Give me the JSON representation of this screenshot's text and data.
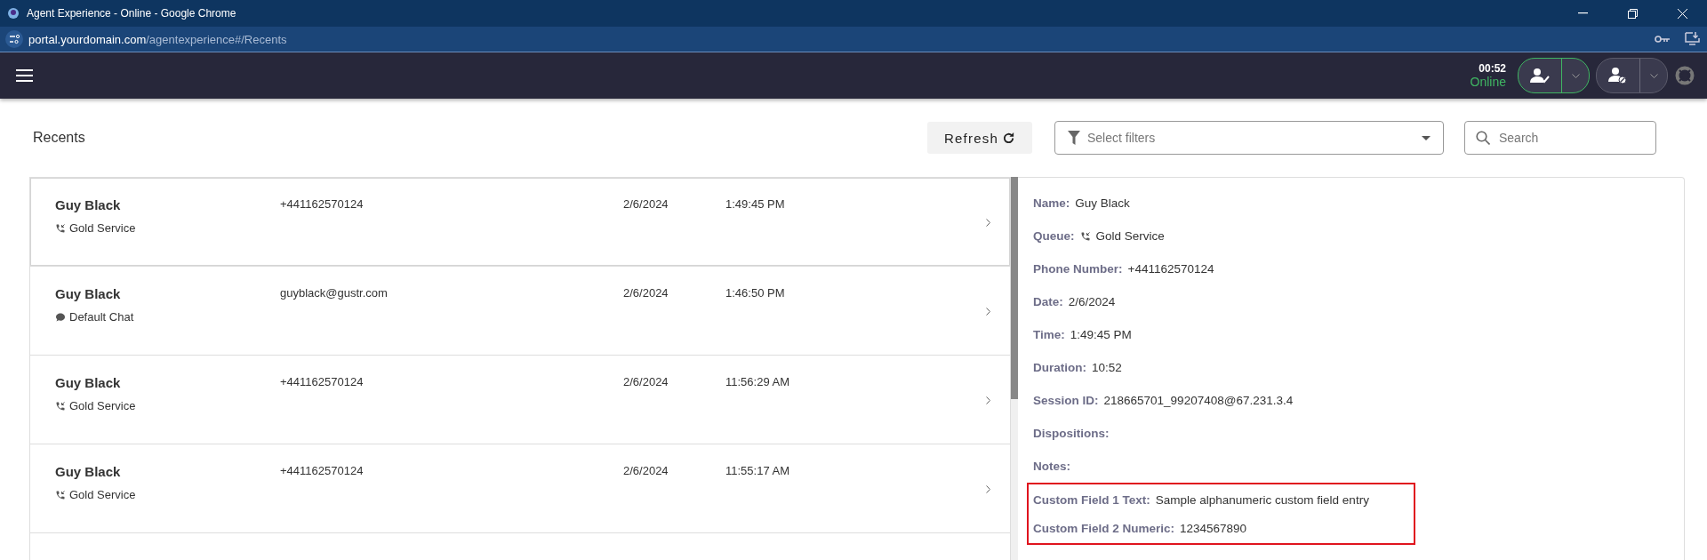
{
  "browser": {
    "title": "Agent Experience - Online - Google Chrome",
    "url_host": "portal.yourdomain.com",
    "url_path": "/agentexperience#/Recents"
  },
  "app_bar": {
    "timer": "00:52",
    "status": "Online"
  },
  "page": {
    "title": "Recents",
    "refresh_label": "Refresh",
    "filter": {
      "placeholder": "Select filters"
    },
    "search": {
      "placeholder": "Search"
    }
  },
  "recents": [
    {
      "name": "Guy Black",
      "kind": "phone",
      "queue": "Gold Service",
      "contact": "+441162570124",
      "date": "2/6/2024",
      "time": "1:49:45 PM",
      "selected": true
    },
    {
      "name": "Guy Black",
      "kind": "chat",
      "queue": "Default Chat",
      "contact": "guyblack@gustr.com",
      "date": "2/6/2024",
      "time": "1:46:50 PM",
      "selected": false
    },
    {
      "name": "Guy Black",
      "kind": "phone",
      "queue": "Gold Service",
      "contact": "+441162570124",
      "date": "2/6/2024",
      "time": "11:56:29 AM",
      "selected": false
    },
    {
      "name": "Guy Black",
      "kind": "phone",
      "queue": "Gold Service",
      "contact": "+441162570124",
      "date": "2/6/2024",
      "time": "11:55:17 AM",
      "selected": false
    }
  ],
  "details": {
    "fields": [
      {
        "label": "Name:",
        "value": "Guy Black"
      },
      {
        "label": "Queue:",
        "value": "Gold Service",
        "kind": "phone"
      },
      {
        "label": "Phone Number:",
        "value": "+441162570124"
      },
      {
        "label": "Date:",
        "value": "2/6/2024"
      },
      {
        "label": "Time:",
        "value": "1:49:45 PM"
      },
      {
        "label": "Duration:",
        "value": "10:52"
      },
      {
        "label": "Session ID:",
        "value": "218665701_99207408@67.231.3.4"
      },
      {
        "label": "Dispositions:"
      },
      {
        "label": "Notes:"
      }
    ],
    "highlighted_fields": [
      {
        "label": "Custom Field 1 Text:",
        "value": "Sample alphanumeric custom field entry"
      },
      {
        "label": "Custom Field 2 Numeric:",
        "value": "1234567890"
      }
    ]
  }
}
